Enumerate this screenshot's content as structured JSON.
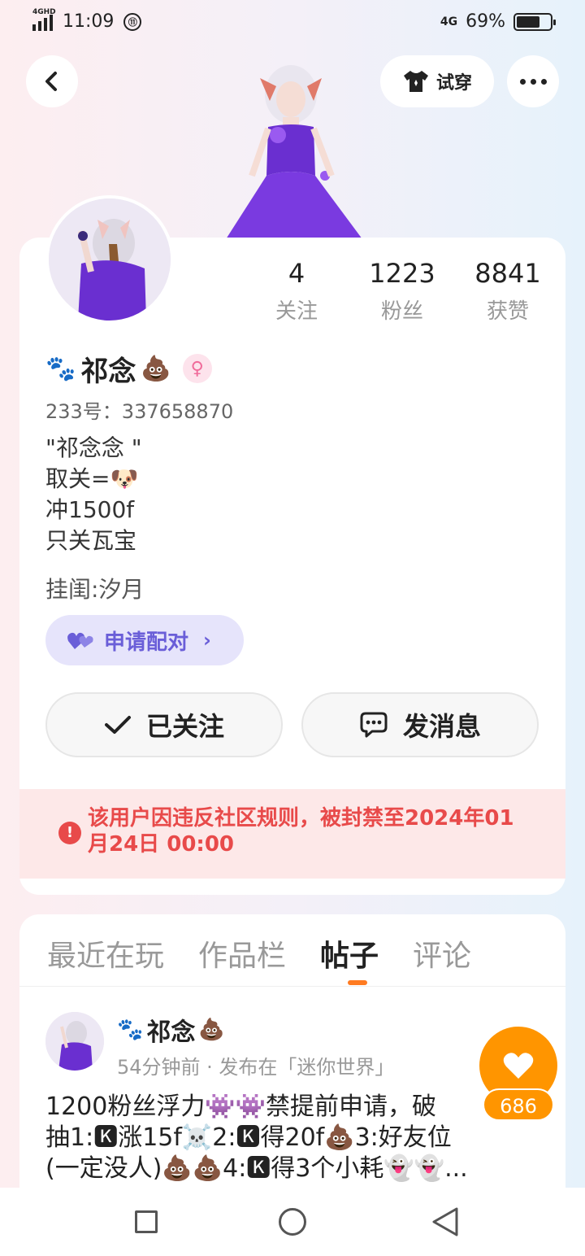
{
  "status_bar": {
    "network": "4GHD",
    "time": "11:09",
    "network_right": "4G",
    "battery": "69%",
    "battery_level": 0.69
  },
  "header": {
    "try_on_label": "试穿"
  },
  "profile": {
    "stats": [
      {
        "value": "4",
        "label": "关注"
      },
      {
        "value": "1223",
        "label": "粉丝"
      },
      {
        "value": "8841",
        "label": "获赞"
      }
    ],
    "name_prefix_emoji": "🐾",
    "name": "祁念",
    "name_suffix_emoji": "💩",
    "gender_symbol": "♀",
    "uid": "233号：337658870",
    "bio": [
      "\"祁念念 \"",
      "取关=🐶",
      "冲1500f",
      "只关瓦宝"
    ],
    "hang": "挂闺:汐月",
    "pair_label": "申请配对",
    "follow_label": "已关注",
    "message_label": "发消息",
    "ban_notice": "该用户因违反社区规则，被封禁至2024年01月24日 00:00"
  },
  "tabs": [
    "最近在玩",
    "作品栏",
    "帖子",
    "评论"
  ],
  "active_tab": "帖子",
  "post": {
    "author_prefix_emoji": "🐾",
    "author": "祁念",
    "author_suffix_emoji": "💩",
    "meta": "54分钟前 · 发布在「迷你世界」",
    "lines": [
      "1200粉丝浮力👾👾禁提前申请，破",
      "抽1:🅺涨15f☠️2:🅺得20f💩3:好友位",
      "(一定没人)💩💩4:🅺得3个小耗👻👻..."
    ],
    "like_count": "686"
  }
}
